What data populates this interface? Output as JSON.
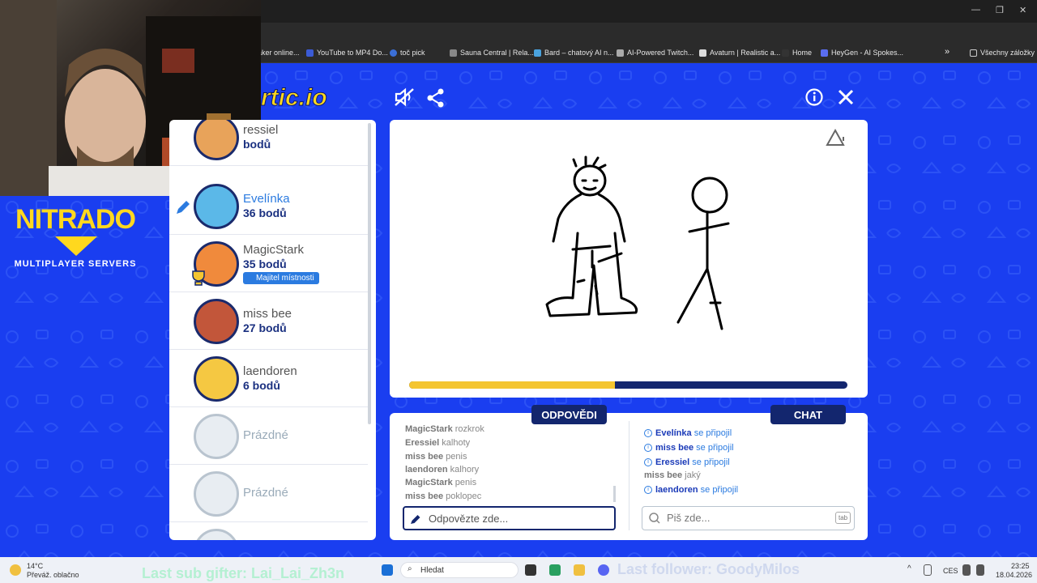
{
  "browser": {
    "bookmarks": [
      "aker online...",
      "YouTube to MP4 Do...",
      "toč pick",
      "Sauna Central | Rela...",
      "Bard – chatový AI n...",
      "AI-Powered Twitch...",
      "Avaturn | Realistic a...",
      "Home",
      "HeyGen - AI Spokes...",
      "Všechny záložky"
    ],
    "more": "»"
  },
  "sponsor": {
    "title": "NITRADO",
    "subtitle": "MULTIPLAYER SERVERS"
  },
  "logo": "rtic.io",
  "players": [
    {
      "name": "ressiel",
      "score": "bodů",
      "avatar_color": "#e8a35a"
    },
    {
      "name": "Evelínka",
      "score": "36 bodů",
      "avatar_color": "#5bb8e8"
    },
    {
      "name": "MagicStark",
      "score": "35 bodů",
      "badge": "Majitel místnosti",
      "avatar_color": "#f08a3c"
    },
    {
      "name": "miss bee",
      "score": "27 bodů",
      "avatar_color": "#c2563a"
    },
    {
      "name": "laendoren",
      "score": "6 bodů",
      "avatar_color": "#f5c842"
    },
    {
      "name": "Prázdné",
      "empty": true
    },
    {
      "name": "Prázdné",
      "empty": true
    }
  ],
  "round": {
    "progress": 0.47
  },
  "tabs": {
    "answers": "ODPOVĚDI",
    "chat": "CHAT"
  },
  "answers": [
    {
      "player": "MagicStark",
      "text": "rozkrok"
    },
    {
      "player": "Eressiel",
      "text": "kalhoty"
    },
    {
      "player": "miss bee",
      "text": "penis"
    },
    {
      "player": "laendoren",
      "text": "kalhory"
    },
    {
      "player": "MagicStark",
      "text": "penis"
    },
    {
      "player": "miss bee",
      "text": "poklopec"
    }
  ],
  "chat": [
    {
      "player": "Evelínka",
      "text": "se připojil",
      "system": true
    },
    {
      "player": "miss bee",
      "text": "se připojil",
      "system": true
    },
    {
      "player": "Eressiel",
      "text": "se připojil",
      "system": true
    },
    {
      "player": "miss bee",
      "text": "jaký",
      "system": false
    },
    {
      "player": "laendoren",
      "text": "se připojil",
      "system": true
    }
  ],
  "inputs": {
    "answer_placeholder": "Odpovězte zde...",
    "chat_placeholder": "Piš zde...",
    "chat_hint": "tab"
  },
  "stream_overlay": {
    "sub_gifter": "Last sub gifter: Lai_Lai_Zh3n",
    "follower": "Last follower: GoodyMilos"
  },
  "taskbar": {
    "temp": "14°C",
    "weather": "Převáž. oblačno",
    "search": "Hledat",
    "lang": "CES",
    "time": "23:25",
    "date": "18.04.2026"
  },
  "icons": [
    "mute-icon",
    "share-icon",
    "info-icon",
    "close-icon",
    "warning-icon",
    "pencil-icon",
    "search-icon"
  ]
}
